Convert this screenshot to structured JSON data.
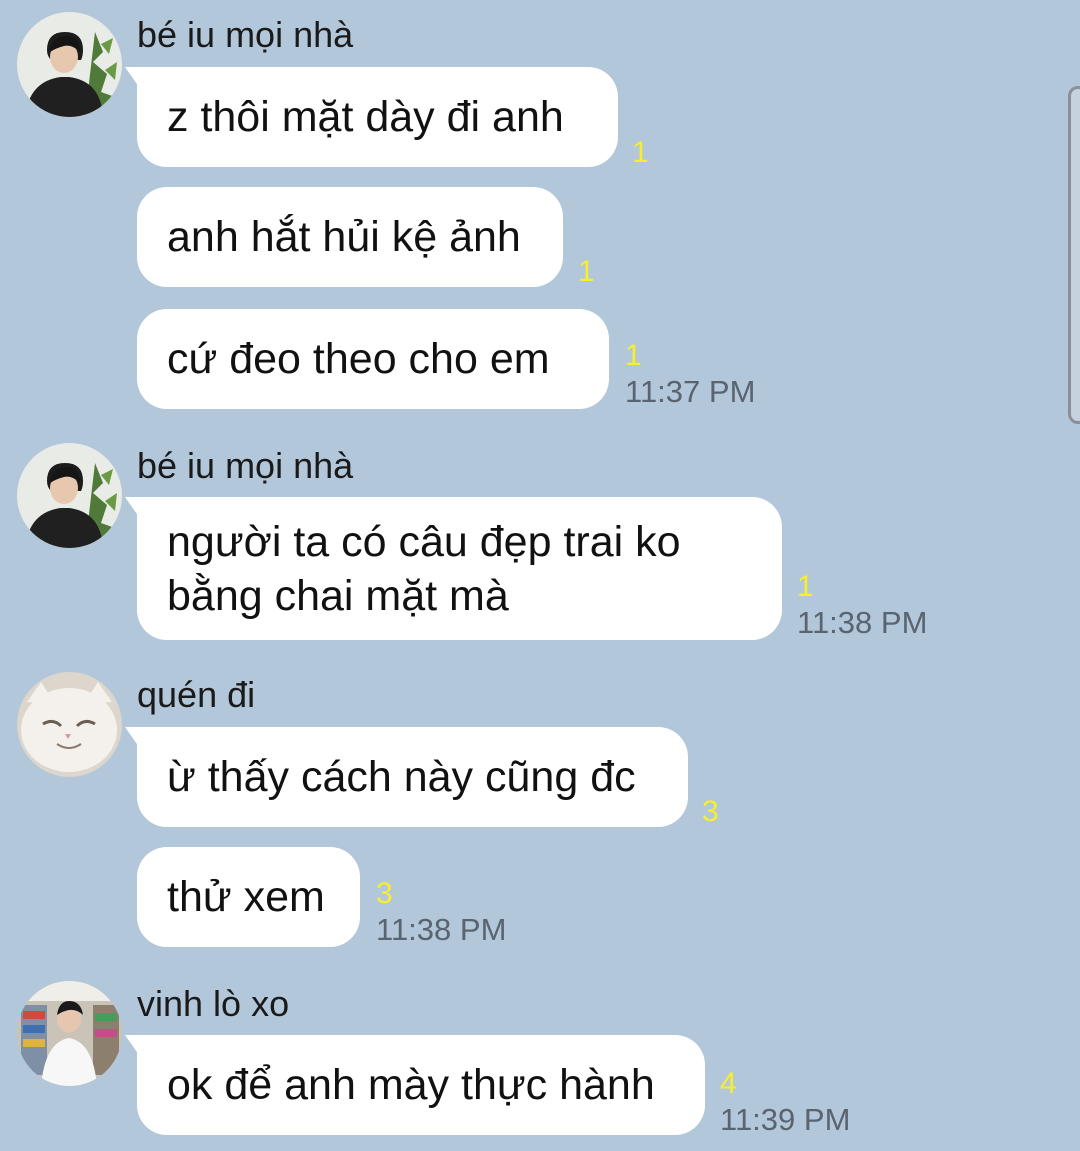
{
  "messages": [
    {
      "sender": "bé iu mọi nhà",
      "avatar": "avatar-guy-dark-hoodie",
      "bubbles": [
        {
          "text": "z thôi mặt dày đi anh",
          "unread": "1",
          "time": ""
        },
        {
          "text": "anh hắt hủi kệ ảnh",
          "unread": "1",
          "time": ""
        },
        {
          "text": "cứ đeo theo cho em",
          "unread": "1",
          "time": "11:37 PM"
        }
      ]
    },
    {
      "sender": "bé iu mọi nhà",
      "avatar": "avatar-guy-dark-hoodie",
      "bubbles": [
        {
          "lines": [
            "người ta có câu đẹp trai ko",
            "bằng chai mặt mà"
          ],
          "unread": "1",
          "time": "11:38 PM"
        }
      ]
    },
    {
      "sender": "quén đi",
      "avatar": "avatar-white-cat",
      "bubbles": [
        {
          "text": "ừ thấy cách này cũng đc",
          "unread": "3",
          "time": ""
        },
        {
          "text": "thử xem",
          "unread": "3",
          "time": "11:38 PM"
        }
      ]
    },
    {
      "sender": "vinh lò xo",
      "avatar": "avatar-guy-store",
      "bubbles": [
        {
          "text": "ok để anh mày thực hành",
          "unread": "4",
          "time": "11:39 PM"
        }
      ]
    }
  ],
  "colors": {
    "background": "#b3c7da",
    "bubble": "#ffffff",
    "unread": "#f7ef2a",
    "time": "#5a6470"
  }
}
